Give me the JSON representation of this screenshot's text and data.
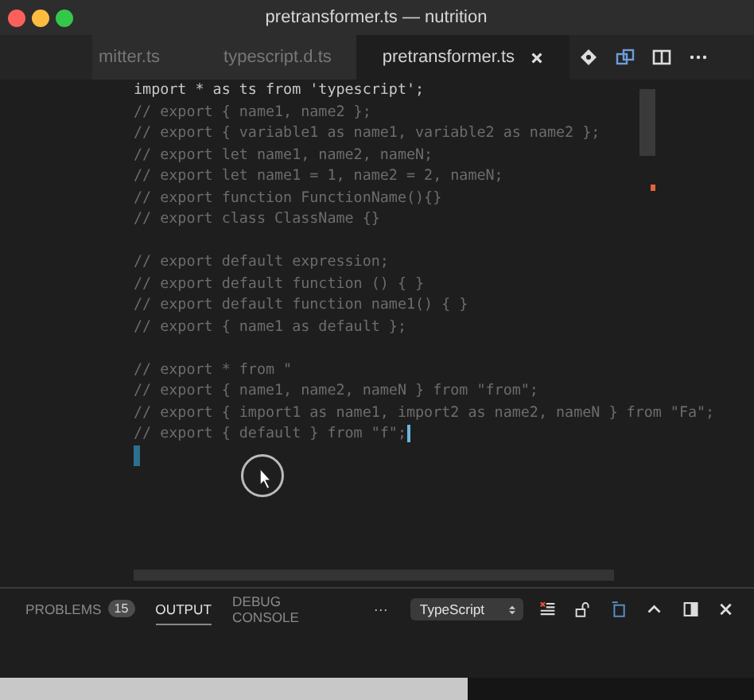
{
  "window": {
    "title": "pretransformer.ts — nutrition"
  },
  "tabs": [
    {
      "label": "mitter.ts",
      "selected": false
    },
    {
      "label": "typescript.d.ts",
      "selected": false
    },
    {
      "label": "pretransformer.ts",
      "selected": true
    }
  ],
  "editor": {
    "lines": [
      {
        "kind": "code",
        "text": "import * as ts from 'typescript';"
      },
      {
        "kind": "comment",
        "text": "// export { name1, name2 };"
      },
      {
        "kind": "comment",
        "text": "// export { variable1 as name1, variable2 as name2 };"
      },
      {
        "kind": "comment",
        "text": "// export let name1, name2, nameN;"
      },
      {
        "kind": "comment",
        "text": "// export let name1 = 1, name2 = 2, nameN;"
      },
      {
        "kind": "comment",
        "text": "// export function FunctionName(){}"
      },
      {
        "kind": "comment",
        "text": "// export class ClassName {}"
      },
      {
        "kind": "blank"
      },
      {
        "kind": "comment",
        "text": "// export default expression;"
      },
      {
        "kind": "comment",
        "text": "// export default function () { }"
      },
      {
        "kind": "comment",
        "text": "// export default function name1() {  }"
      },
      {
        "kind": "comment",
        "text": "// export { name1 as default };"
      },
      {
        "kind": "blank"
      },
      {
        "kind": "comment",
        "text": "// export * from \""
      },
      {
        "kind": "comment",
        "text": "// export { name1, name2, nameN } from \"from\";"
      },
      {
        "kind": "comment",
        "text": "// export { import1 as name1, import2 as name2, nameN } from \"Fa\";"
      },
      {
        "kind": "comment",
        "text": "// export { default } from \"f\";",
        "caret": true
      },
      {
        "kind": "blank",
        "caret": true
      }
    ]
  },
  "panel": {
    "tabs": [
      {
        "label": "PROBLEMS",
        "badge": "15",
        "selected": false
      },
      {
        "label": "OUTPUT",
        "selected": true
      },
      {
        "label": "DEBUG CONSOLE",
        "selected": false
      }
    ],
    "more": "···",
    "channel": "TypeScript"
  }
}
